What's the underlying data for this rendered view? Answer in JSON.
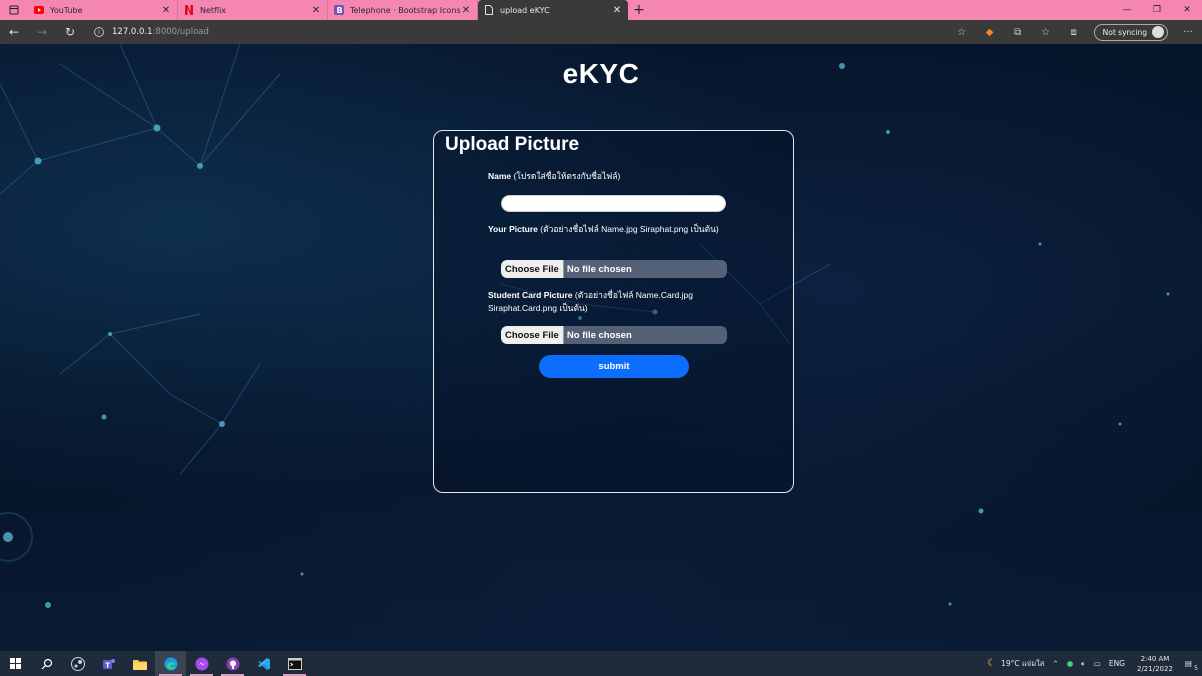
{
  "browser": {
    "tabs": [
      {
        "title": "YouTube",
        "icon": "youtube-icon",
        "active": false
      },
      {
        "title": "Netflix",
        "icon": "netflix-icon",
        "active": false
      },
      {
        "title": "Telephone · Bootstrap Icons",
        "icon": "bootstrap-icon",
        "active": false
      },
      {
        "title": "upload eKYC",
        "icon": "page-icon",
        "active": true
      }
    ],
    "address": {
      "host": "127.0.0.1",
      "path": ":8000/upload"
    },
    "sync_label": "Not syncing"
  },
  "page": {
    "brand": "eKYC",
    "card_title": "Upload Picture",
    "fields": {
      "name_label": "Name",
      "name_hint": "(โปรดใส่ชื่อให้ตรงกับชื่อไฟล์)",
      "name_value": "",
      "picture_label": "Your Picture",
      "picture_hint": "(ตัวอย่างชื่อไฟล์ Name.jpg Siraphat.png เป็นต้น)",
      "card_label": "Student Card Picture",
      "card_hint": "(ตัวอย่างชื่อไฟล์ Name.Card.jpg Siraphat.Card.png เป็นต้น)",
      "choose_label": "Choose File",
      "no_file_label": "No file chosen"
    },
    "submit_label": "submit"
  },
  "taskbar": {
    "apps": [
      "start-icon",
      "search-icon",
      "steam-icon",
      "teams-icon",
      "file-explorer-icon",
      "edge-icon",
      "messenger-icon",
      "github-icon",
      "vscode-icon",
      "terminal-icon"
    ],
    "weather": "19°C",
    "weather_desc": "แจ่มใส",
    "language": "ENG",
    "time": "2:40 AM",
    "date": "2/21/2022",
    "notifications": "5"
  },
  "colors": {
    "tab_strip": "#f486b1",
    "toolbar": "#3a3a3a",
    "page_bg": "#061226",
    "submit": "#0d6efd",
    "taskbar": "#1f2b3a"
  }
}
